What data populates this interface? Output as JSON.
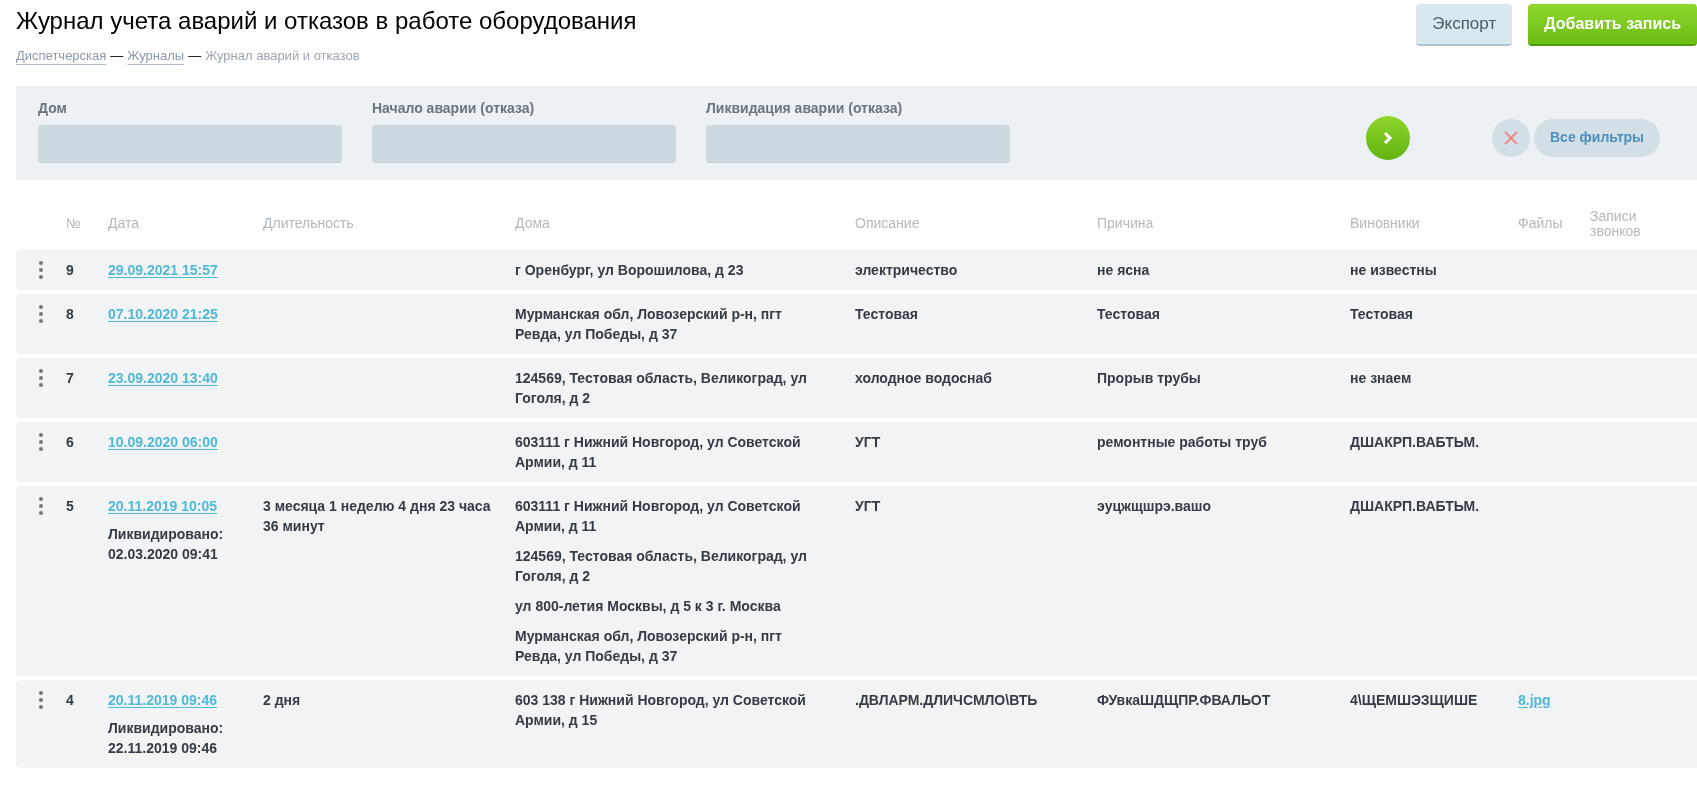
{
  "page": {
    "title": "Журнал учета аварий и отказов в работе оборудования"
  },
  "breadcrumbs": [
    {
      "label": "Диспетчерская",
      "kind": "link"
    },
    {
      "separator": "—",
      "label": "Журналы",
      "kind": "link"
    },
    {
      "separator": "—",
      "label": "Журнал аварий и отказов",
      "kind": "current"
    }
  ],
  "actions": [
    {
      "label": "Экспорт",
      "kind": "secondary"
    },
    {
      "label": "Добавить запись",
      "kind": "primary"
    }
  ],
  "filters": {
    "fields": [
      {
        "label": "Дом"
      },
      {
        "label": "Начало аварии (отказа)"
      },
      {
        "label": "Ликвидация аварии (отказа)"
      }
    ],
    "all_filters": "Все фильтры"
  },
  "table": {
    "columns": [
      "№",
      "Дата",
      "Длительность",
      "Дома",
      "Описание",
      "Причина",
      "Виновники",
      "Файлы",
      "Записи звонков"
    ],
    "rows": [
      {
        "number": "9",
        "date": "29.09.2021 15:57",
        "houses": [
          "г Оренбург, ул Ворошилова, д 23"
        ],
        "description": "электричество",
        "cause": "не ясна",
        "culprits": "не известны"
      },
      {
        "number": "8",
        "date": "07.10.2020 21:25",
        "houses": [
          "Мурманская обл, Ловозерский р-н, пгт Ревда, ул Победы, д 37"
        ],
        "description": "Тестовая",
        "cause": "Тестовая",
        "culprits": "Тестовая"
      },
      {
        "number": "7",
        "date": "23.09.2020 13:40",
        "houses": [
          "124569, Тестовая область, Великоград, ул Гоголя, д 2"
        ],
        "description": "холодное водоснаб",
        "cause": "Прорыв трубы",
        "culprits": "не знаем"
      },
      {
        "number": "6",
        "date": "10.09.2020 06:00",
        "houses": [
          "603111 г Нижний Новгород, ул Советской Армии, д 11"
        ],
        "description": "УГТ",
        "cause": "ремонтные работы труб",
        "culprits": "ДШАКРП.ВАБТЬМ."
      },
      {
        "number": "5",
        "date": "20.11.2019 10:05",
        "liquidated_label": "Ликвидировано:",
        "liquidated": "02.03.2020 09:41",
        "duration": "3 месяца 1 неделю 4 дня 23 часа 36 минут",
        "houses": [
          "603111 г Нижний Новгород, ул Советской Армии, д 11",
          "124569, Тестовая область, Великоград, ул Гоголя, д 2",
          "ул 800-летия Москвы, д 5 к 3 г. Москва",
          "Мурманская обл, Ловозерский р-н, пгт Ревда, ул Победы, д 37"
        ],
        "description": "УГТ",
        "cause": "эуцжщшрэ.вашо",
        "culprits": "ДШАКРП.ВАБТЬМ."
      },
      {
        "number": "4",
        "date": "20.11.2019 09:46",
        "liquidated_label": "Ликвидировано:",
        "liquidated": "22.11.2019 09:46",
        "duration": "2 дня",
        "houses": [
          "603 138 г Нижний Новгород, ул Советской Армии, д 15"
        ],
        "description": ".ДВЛАРМ.ДЛИЧСМЛО\\ВТЬ",
        "cause": "ФУвкаШДЩПР.ФВАЛЬОТ",
        "culprits": "4\\ЩЕМШЭЗЩИШЕ",
        "files": [
          "8.jpg"
        ]
      }
    ]
  }
}
